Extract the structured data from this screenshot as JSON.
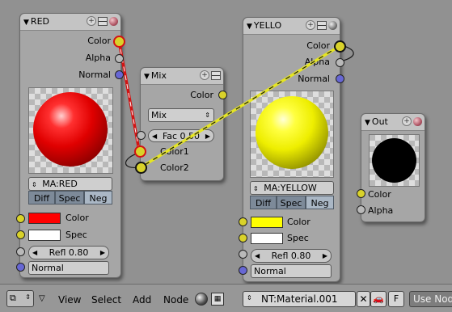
{
  "nodes": {
    "red": {
      "title": "RED",
      "outputs": [
        "Color",
        "Alpha",
        "Normal"
      ],
      "material": "MA:RED",
      "tabs": [
        "Diff",
        "Spec",
        "Neg"
      ],
      "color_label": "Color",
      "spec_label": "Spec",
      "refl": "Refl 0.80",
      "normal_label": "Normal",
      "color_swatch": "#ff0000",
      "spec_swatch": "#ffffff"
    },
    "mix": {
      "title": "Mix",
      "output": "Color",
      "blend_mode": "Mix",
      "fac": "Fac 0.50",
      "inputs": [
        "Color1",
        "Color2"
      ]
    },
    "yellow": {
      "title": "YELLO",
      "outputs": [
        "Color",
        "Alpha",
        "Normal"
      ],
      "material": "MA:YELLOW",
      "tabs": [
        "Diff",
        "Spec",
        "Neg"
      ],
      "color_label": "Color",
      "spec_label": "Spec",
      "refl": "Refl 0.80",
      "normal_label": "Normal",
      "color_swatch": "#ffff00",
      "spec_swatch": "#ffffff"
    },
    "out": {
      "title": "Out",
      "inputs": [
        "Color",
        "Alpha"
      ]
    }
  },
  "header": {
    "menus": [
      "View",
      "Select",
      "Add",
      "Node"
    ],
    "nodetree": "NT:Material.001",
    "fake_user": "F",
    "use_nodes": "Use Nod"
  },
  "colors": {
    "link_red_selected": "#d21313",
    "link_yellow": "#e5e522",
    "canvas": "#919191",
    "node_body": "#a6a6a6"
  }
}
